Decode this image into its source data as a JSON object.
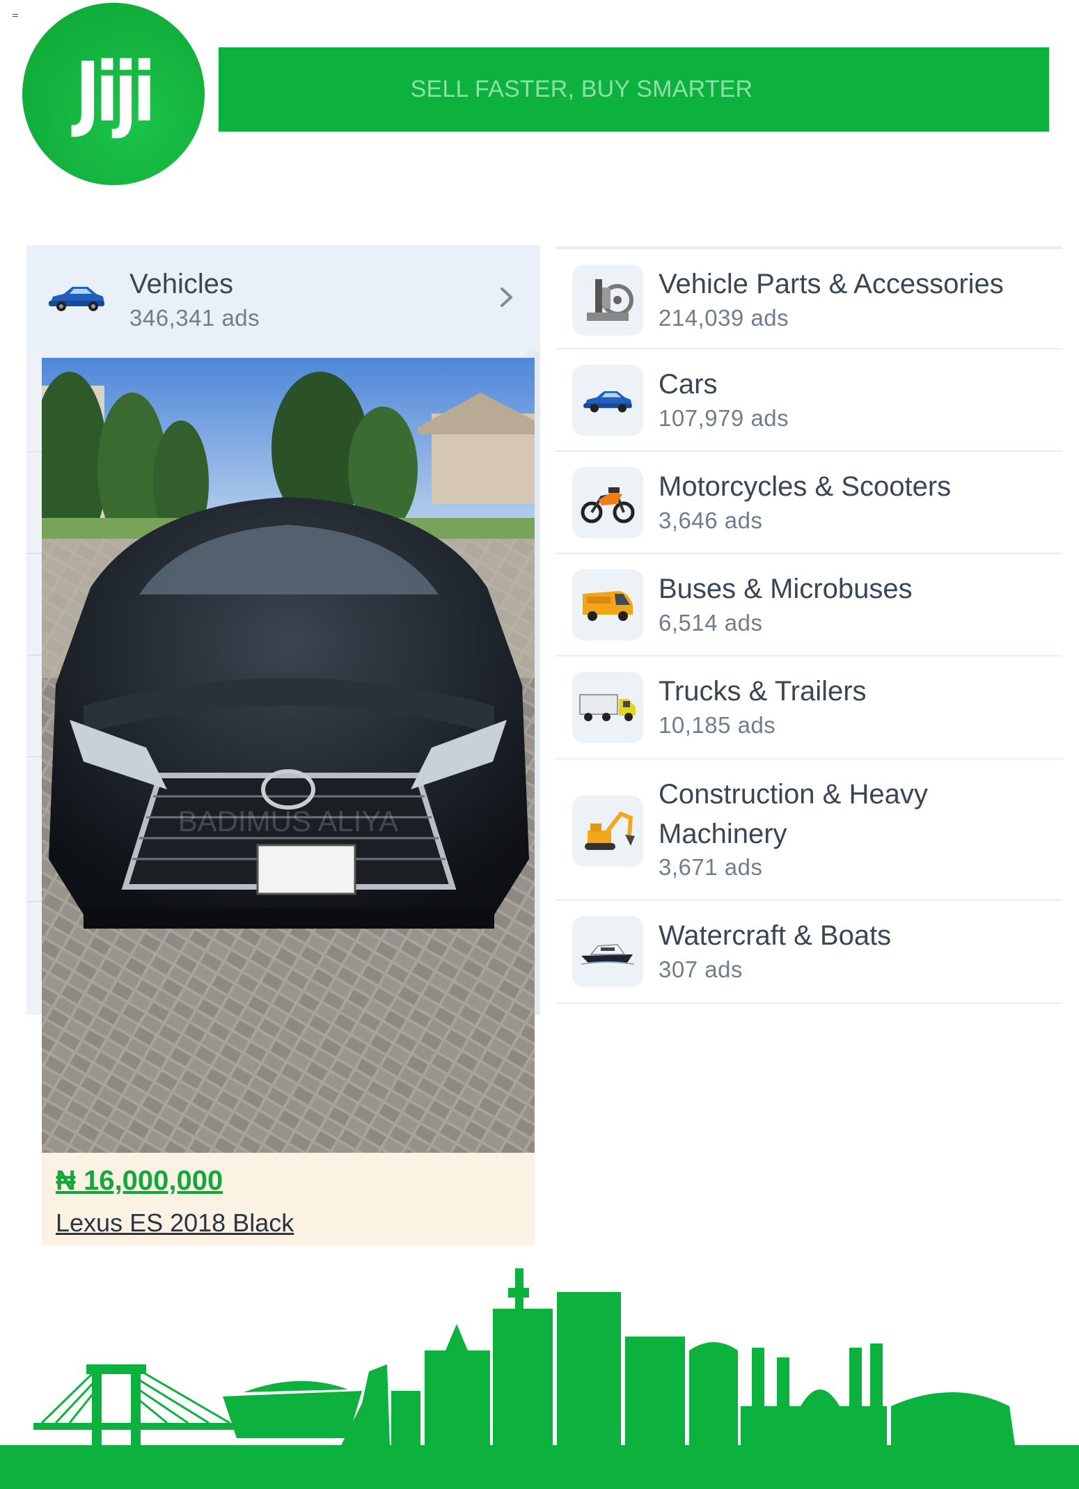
{
  "header": {
    "logo_text": "Jiji",
    "tagline": "SELL FASTER, BUY SMARTER"
  },
  "colors": {
    "brand_green": "#0cb23d",
    "panel_bg": "#eef2f7",
    "price_green": "#12a83b",
    "ad_footer_bg": "#fcf2e3"
  },
  "main_category": {
    "icon": "car-icon",
    "title": "Vehicles",
    "count": "346,341 ads"
  },
  "subcategories": [
    {
      "icon": "vehicle-parts-icon",
      "title": "Vehicle Parts & Accessories",
      "count": "214,039 ads"
    },
    {
      "icon": "car-icon",
      "title": "Cars",
      "count": "107,979 ads"
    },
    {
      "icon": "motorcycle-icon",
      "title": "Motorcycles & Scooters",
      "count": "3,646 ads"
    },
    {
      "icon": "bus-icon",
      "title": "Buses & Microbuses",
      "count": "6,514 ads"
    },
    {
      "icon": "truck-icon",
      "title": "Trucks & Trailers",
      "count": "10,185 ads"
    },
    {
      "icon": "excavator-icon",
      "title": "Construction & Heavy Machinery",
      "count": "3,671 ads"
    },
    {
      "icon": "boat-icon",
      "title": "Watercraft & Boats",
      "count": "307 ads"
    }
  ],
  "ad": {
    "price": "₦ 16,000,000",
    "title": "Lexus ES 2018 Black",
    "photo_watermark": "BADIMUS ALIYA"
  }
}
